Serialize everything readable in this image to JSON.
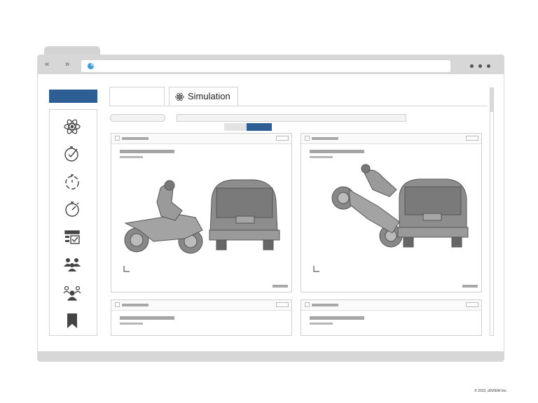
{
  "browser": {
    "back_label": "‹‹",
    "forward_label": "››",
    "url": "",
    "page_icon": "pie-chart-icon",
    "menu_icon": "more-dots-icon"
  },
  "sidebar": {
    "header_label": "",
    "items": [
      {
        "icon": "atom-icon"
      },
      {
        "icon": "stopwatch-check-icon"
      },
      {
        "icon": "dashed-stopwatch-icon"
      },
      {
        "icon": "stopwatch-icon"
      },
      {
        "icon": "checklist-icon"
      },
      {
        "icon": "user-group-icon"
      },
      {
        "icon": "user-network-icon"
      },
      {
        "icon": "bookmark-icon"
      }
    ]
  },
  "tabs": [
    {
      "label": ""
    },
    {
      "label": "Simulation",
      "icon": "atom-icon"
    }
  ],
  "panels": [
    {
      "scene": "motorcycle rider approaching rear of van"
    },
    {
      "scene": "motorcycle rider thrown over rear of van"
    },
    {},
    {}
  ],
  "colors": {
    "accent": "#2d5f95",
    "chrome": "#d7d7d7",
    "border": "#cfcfcf"
  },
  "footer": {
    "copyright": "© 2022, d3VIEW Inc."
  }
}
